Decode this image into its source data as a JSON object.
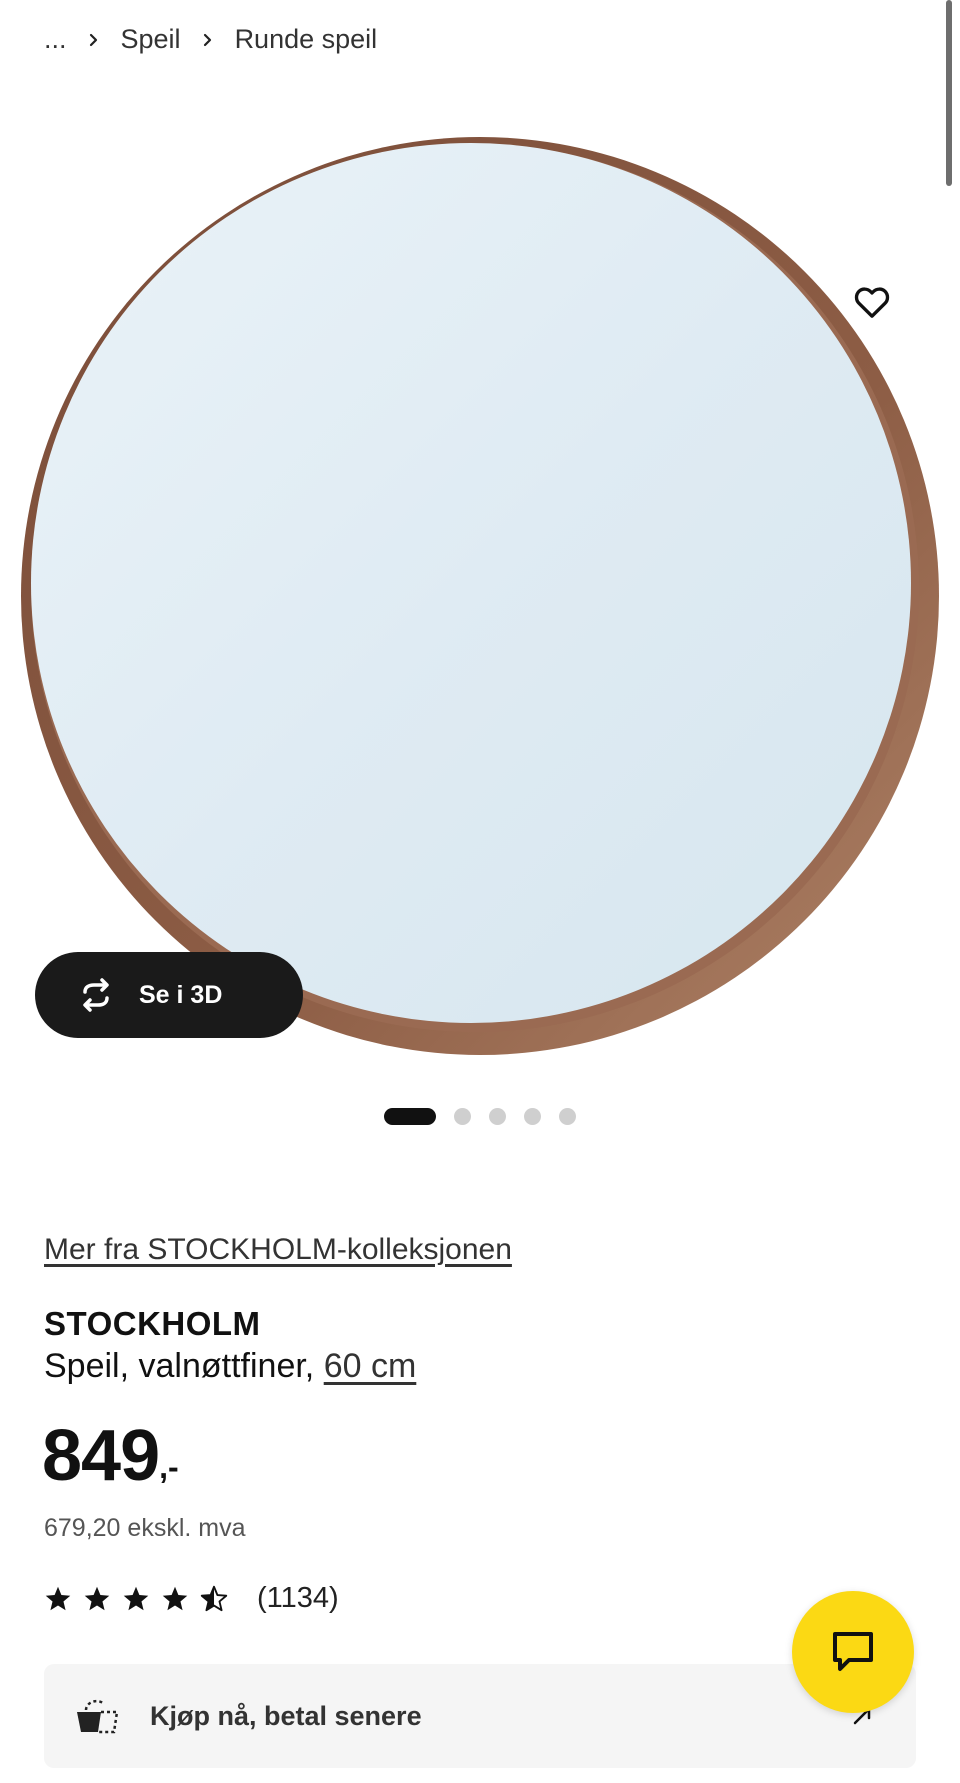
{
  "breadcrumb": {
    "items": [
      "...",
      "Speil",
      "Runde speil"
    ]
  },
  "gallery": {
    "view_3d_label": "Se i 3D",
    "active_slide": 1,
    "slide_count": 5
  },
  "product": {
    "collection_link": "Mer fra STOCKHOLM-kolleksjonen",
    "name": "STOCKHOLM",
    "description": "Speil, valnøttfiner,",
    "size": "60 cm",
    "price_main": "849",
    "price_suffix": ",-",
    "price_ex_vat": "679,20 ekskl. mva",
    "rating_stars": 4.5,
    "rating_count": "(1134)"
  },
  "pay_later": {
    "label": "Kjøp nå, betal senere"
  },
  "icons": {
    "favorite": "heart-outline-icon",
    "view3d": "rotate-3d-icon",
    "chat": "chat-icon",
    "pay": "basket-icon"
  },
  "colors": {
    "chat_fab": "#fbd914",
    "frame": "#8a5a42",
    "mirror_glass": "#dbe9f2"
  }
}
